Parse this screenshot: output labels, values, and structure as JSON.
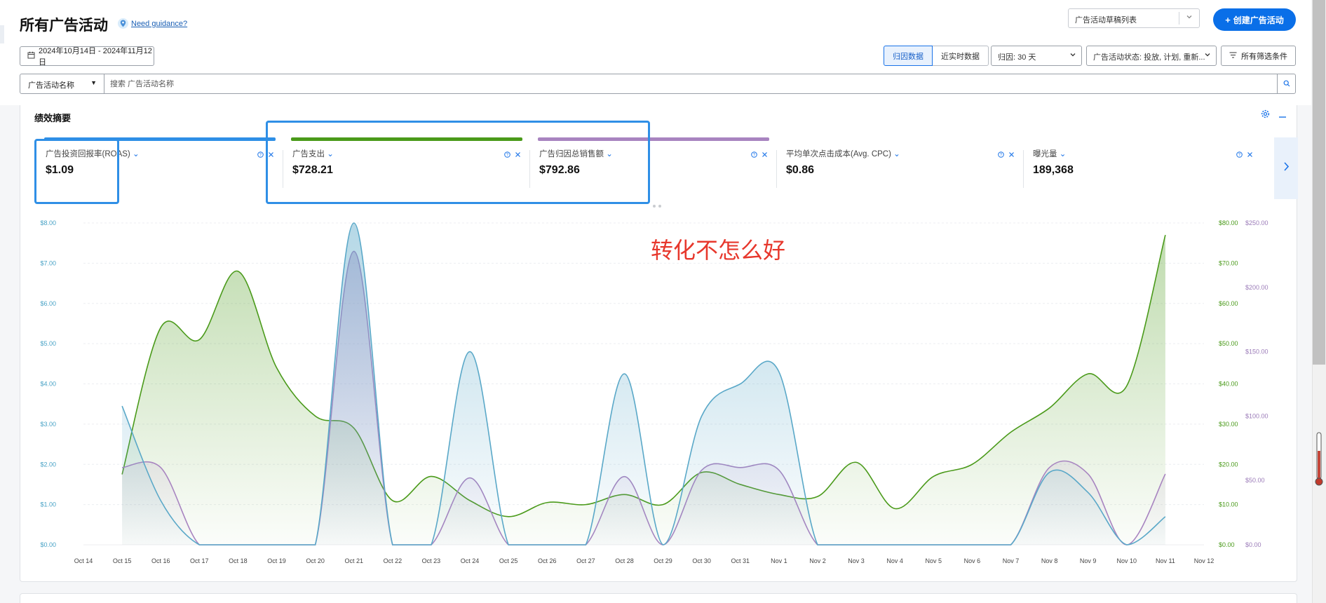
{
  "header": {
    "title": "所有广告活动",
    "guidance_link": "Need guidance?",
    "draft_select": "广告活动草稿列表",
    "create_button": "创建广告活动"
  },
  "toolbar": {
    "date_range": "2024年10月14日 - 2024年11月12日",
    "attribution_toggle": [
      "归因数据",
      "近实时数据"
    ],
    "attribution_window": "归因: 30 天",
    "status_filter": "广告活动状态: 投放, 计划, 重新...",
    "all_filters": "所有筛选条件"
  },
  "search": {
    "type": "广告活动名称",
    "placeholder": "搜索 广告活动名称"
  },
  "summary": {
    "title": "绩效摘要",
    "metrics": [
      {
        "name": "广告投资回报率(ROAS)",
        "value": "$1.09",
        "bar_color": "#2e8fe6"
      },
      {
        "name": "广告支出",
        "value": "$728.21",
        "bar_color": "#4a9a1a"
      },
      {
        "name": "广告归因总销售额",
        "value": "$792.86",
        "bar_color": "#a884c0"
      },
      {
        "name": "平均单次点击成本(Avg. CPC)",
        "value": "$0.86",
        "bar_color": ""
      },
      {
        "name": "曝光量",
        "value": "189,368",
        "bar_color": ""
      }
    ]
  },
  "annotation": {
    "text": "转化不怎么好",
    "color": "#e7372c"
  },
  "chart_data": {
    "type": "line",
    "x": [
      "Oct 14",
      "Oct 15",
      "Oct 16",
      "Oct 17",
      "Oct 18",
      "Oct 19",
      "Oct 20",
      "Oct 21",
      "Oct 22",
      "Oct 23",
      "Oct 24",
      "Oct 25",
      "Oct 26",
      "Oct 27",
      "Oct 28",
      "Oct 29",
      "Oct 30",
      "Oct 31",
      "Nov 1",
      "Nov 2",
      "Nov 3",
      "Nov 4",
      "Nov 5",
      "Nov 6",
      "Nov 7",
      "Nov 8",
      "Nov 9",
      "Nov 10",
      "Nov 11",
      "Nov 12"
    ],
    "y_left": {
      "ticks": [
        "$0.00",
        "$1.00",
        "$2.00",
        "$3.00",
        "$4.00",
        "$5.00",
        "$6.00",
        "$7.00",
        "$8.00"
      ],
      "range": [
        0,
        8
      ],
      "color": "#4aa3c6"
    },
    "y_right_1": {
      "ticks": [
        "$0.00",
        "$10.00",
        "$20.00",
        "$30.00",
        "$40.00",
        "$50.00",
        "$60.00",
        "$70.00",
        "$80.00"
      ],
      "range": [
        0,
        80
      ],
      "color": "#4a9a1a"
    },
    "y_right_2": {
      "ticks": [
        "$0.00",
        "$50.00",
        "$100.00",
        "$150.00",
        "$200.00",
        "$250.00"
      ],
      "range": [
        0,
        250
      ],
      "color": "#9b7bb8"
    },
    "series": [
      {
        "axis": "y_left",
        "color": "#5aa8c8",
        "values": [
          null,
          3.45,
          1.1,
          0,
          0,
          0,
          0,
          8.0,
          0,
          0,
          4.8,
          0,
          0,
          0,
          4.25,
          0,
          3.2,
          4.0,
          4.3,
          0,
          0,
          0,
          0,
          0,
          0,
          1.8,
          1.3,
          0,
          0.7,
          null
        ]
      },
      {
        "axis": "y_right_1",
        "color": "#4a9a1a",
        "values": [
          null,
          17.5,
          54,
          51,
          68,
          44,
          32,
          29,
          11,
          17,
          11,
          7,
          10.5,
          10,
          12.5,
          10,
          18,
          15,
          12.5,
          12,
          20.5,
          9,
          17,
          20,
          28,
          34,
          42.5,
          39.5,
          77,
          null
        ]
      },
      {
        "axis": "y_right_2",
        "color": "#a884c0",
        "values": [
          null,
          60,
          60,
          0,
          0,
          0,
          0,
          228,
          0,
          0,
          52,
          0,
          0,
          0,
          53,
          0,
          58,
          60,
          58,
          0,
          0,
          0,
          0,
          0,
          0,
          60,
          55,
          0,
          55,
          null
        ]
      }
    ],
    "grid": true
  }
}
